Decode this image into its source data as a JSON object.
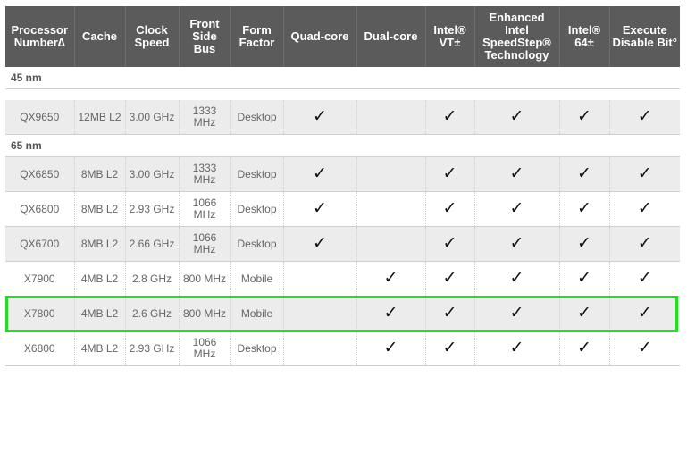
{
  "table": {
    "headers": [
      "Processor Number∆",
      "Cache",
      "Clock Speed",
      "Front Side Bus",
      "Form Factor",
      "Quad-core",
      "Dual-core",
      "Intel® VT±",
      "Enhanced Intel SpeedStep® Technology",
      "Intel® 64±",
      "Execute Disable Bit°"
    ],
    "groups": [
      {
        "label": "45 nm",
        "rows": [
          {
            "processor": "QX9650",
            "cache": "12MB L2",
            "clock": "3.00 GHz",
            "fsb": "1333 MHz",
            "form": "Desktop",
            "quad": true,
            "dual": false,
            "vt": true,
            "speedstep": true,
            "intel64": true,
            "xd": true
          }
        ]
      },
      {
        "label": "65 nm",
        "rows": [
          {
            "processor": "QX6850",
            "cache": "8MB L2",
            "clock": "3.00 GHz",
            "fsb": "1333 MHz",
            "form": "Desktop",
            "quad": true,
            "dual": false,
            "vt": true,
            "speedstep": true,
            "intel64": true,
            "xd": true
          },
          {
            "processor": "QX6800",
            "cache": "8MB L2",
            "clock": "2.93 GHz",
            "fsb": "1066 MHz",
            "form": "Desktop",
            "quad": true,
            "dual": false,
            "vt": true,
            "speedstep": true,
            "intel64": true,
            "xd": true
          },
          {
            "processor": "QX6700",
            "cache": "8MB L2",
            "clock": "2.66 GHz",
            "fsb": "1066 MHz",
            "form": "Desktop",
            "quad": true,
            "dual": false,
            "vt": true,
            "speedstep": true,
            "intel64": true,
            "xd": true
          },
          {
            "processor": "X7900",
            "cache": "4MB L2",
            "clock": "2.8 GHz",
            "fsb": "800 MHz",
            "form": "Mobile",
            "quad": false,
            "dual": true,
            "vt": true,
            "speedstep": true,
            "intel64": true,
            "xd": true
          },
          {
            "processor": "X7800",
            "cache": "4MB L2",
            "clock": "2.6 GHz",
            "fsb": "800 MHz",
            "form": "Mobile",
            "quad": false,
            "dual": true,
            "vt": true,
            "speedstep": true,
            "intel64": true,
            "xd": true,
            "highlighted": true
          },
          {
            "processor": "X6800",
            "cache": "4MB L2",
            "clock": "2.93 GHz",
            "fsb": "1066 MHz",
            "form": "Desktop",
            "quad": false,
            "dual": true,
            "vt": true,
            "speedstep": true,
            "intel64": true,
            "xd": true
          }
        ]
      }
    ],
    "check_glyph": "✓",
    "colors": {
      "header_bg": "#5b5b5b",
      "row_alt": "#ececec",
      "highlight": "#22dd22"
    }
  }
}
